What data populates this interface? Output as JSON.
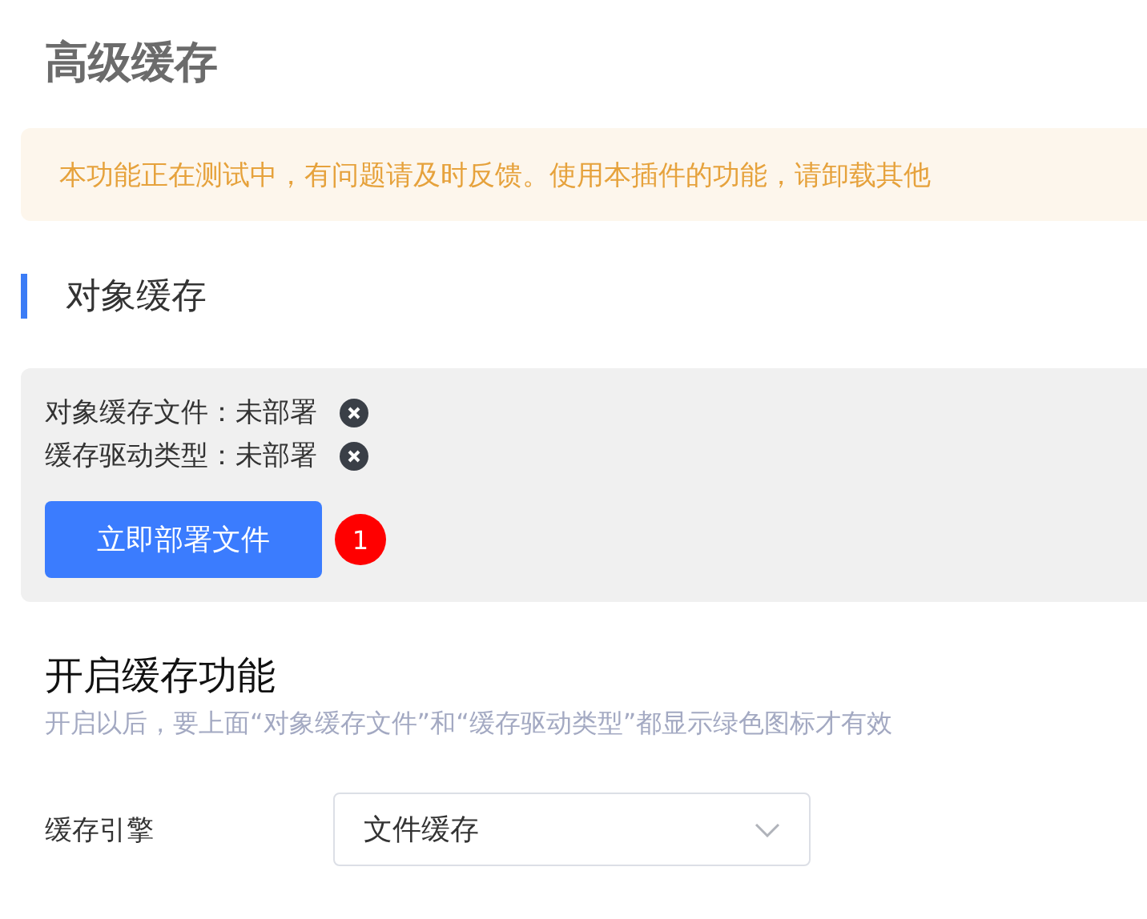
{
  "page_title": "高级缓存",
  "notice": "本功能正在测试中，有问题请及时反馈。使用本插件的功能，请卸载其他",
  "section": {
    "title": "对象缓存",
    "status_items": [
      {
        "label": "对象缓存文件：未部署",
        "deployed": false
      },
      {
        "label": "缓存驱动类型：未部署",
        "deployed": false
      }
    ],
    "deploy_button": "立即部署文件",
    "badge": "1"
  },
  "enable": {
    "title": "开启缓存功能",
    "hint": "开启以后，要上面“对象缓存文件”和“缓存驱动类型”都显示绿色图标才有效"
  },
  "form": [
    {
      "label": "缓存引擎",
      "value": "文件缓存"
    }
  ]
}
